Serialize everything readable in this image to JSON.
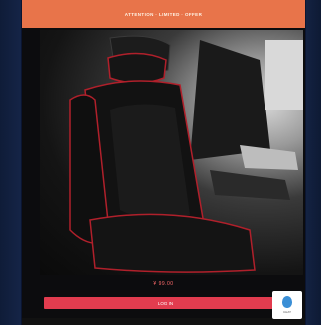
{
  "header": {
    "title": "ATTENTION · LIMITED · OFFER"
  },
  "product": {
    "price_text": "¥ 99.00"
  },
  "actions": {
    "buy_label": "LOG IN"
  },
  "chat": {
    "label": "CHAT"
  },
  "colors": {
    "header_bg": "#e8744a",
    "button_bg": "#e23c4f",
    "page_bg": "#17284d",
    "seat_stitch": "#b0202b"
  },
  "icons": [
    "chat-bubble-icon"
  ]
}
